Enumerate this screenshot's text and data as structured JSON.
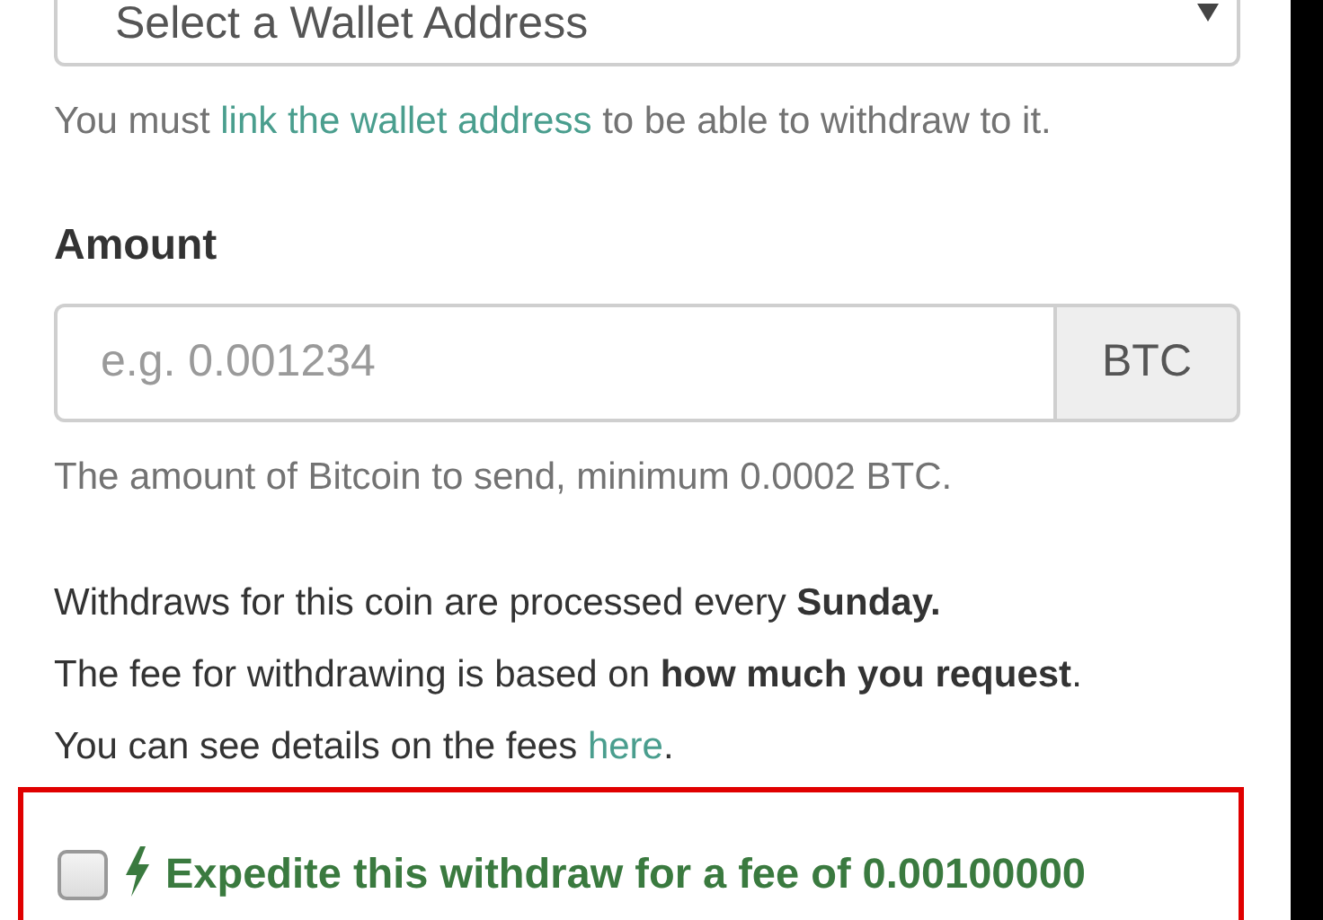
{
  "wallet_select": {
    "placeholder": "Select a Wallet Address"
  },
  "wallet_help": {
    "before": "You must ",
    "link": "link the wallet address",
    "after": " to be able to withdraw to it."
  },
  "amount": {
    "label": "Amount",
    "placeholder": "e.g. 0.001234",
    "addon": "BTC",
    "help": "The amount of Bitcoin to send, minimum 0.0002 BTC."
  },
  "info_lines": [
    {
      "text": "Withdraws for this coin are processed every **Sunday.**"
    },
    {
      "text": "The fee for withdrawing is based on **how much you request**."
    },
    {
      "text": "You can see details on the fees ",
      "link": "here",
      "after": "."
    }
  ],
  "expedite": {
    "checked": false,
    "label": "Expedite this withdraw for a fee of 0.00100000"
  }
}
